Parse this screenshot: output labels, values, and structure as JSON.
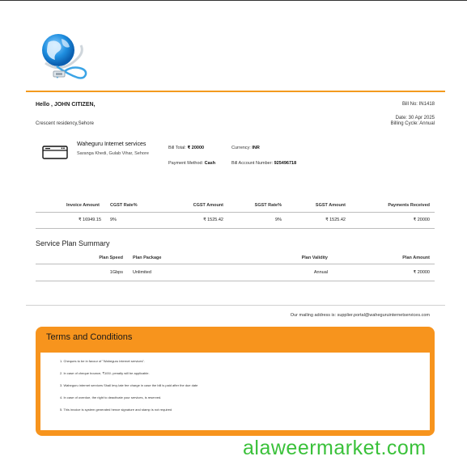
{
  "header": {
    "greeting": "Hello , JOHN CITIZEN,",
    "address": "Crescent residency,Sehore",
    "bill_no": "Bill No: IN1418",
    "date": "Date: 30 Apr 2025",
    "billing_cycle": "Billing Cycle: Annual"
  },
  "company": {
    "name": "Waheguru Internet services",
    "address": "Saranga Khedi, Gulab Vihar, Sehore"
  },
  "summary": {
    "bill_total_label": "Bill Total:",
    "bill_total_value": "₹ 20000",
    "currency_label": "Currency:",
    "currency_value": "INR",
    "payment_method_label": "Payment Method:",
    "payment_method_value": "Cash",
    "account_number_label": "Bill Account Number:",
    "account_number_value": "925496718"
  },
  "charges": {
    "headers": [
      "Invoice Amount",
      "CGST Rate%",
      "CGST Amount",
      "SGST Rate%",
      "SGST Amount",
      "Payments Received"
    ],
    "row": [
      "₹ 16949.15",
      "9%",
      "₹ 1525.42",
      "9%",
      "₹ 1525.42",
      "₹ 20000"
    ]
  },
  "plan": {
    "title": "Service Plan Summary",
    "headers": [
      "Plan Speed",
      "Plan Package",
      "Plan Validity",
      "Plan Amount"
    ],
    "row": [
      "1Gbps",
      "Unlimited",
      "Annual",
      "₹ 20000"
    ]
  },
  "mailing": "Our mailing address is: supplier.portal@waheguruinternetservices.com",
  "terms": {
    "title": "Terms and Conditions",
    "items": [
      "1. Cheques to be in favour of \"Waheguru internet services\".",
      "2. In case of cheque bounce, ₹100/- penalty will be applicable.",
      "3. Waheguru internet services Shall levy late fee charge in case the bill is paid after the due date",
      "4. In case of overdue, the right to deactivate your services, is reserved.",
      "5. This invoice is system generated hence signature and stamp is not required"
    ]
  },
  "watermark": "alaweermarket.com",
  "colors": {
    "accent": "#f7941d",
    "watermark": "#3ac13a"
  }
}
